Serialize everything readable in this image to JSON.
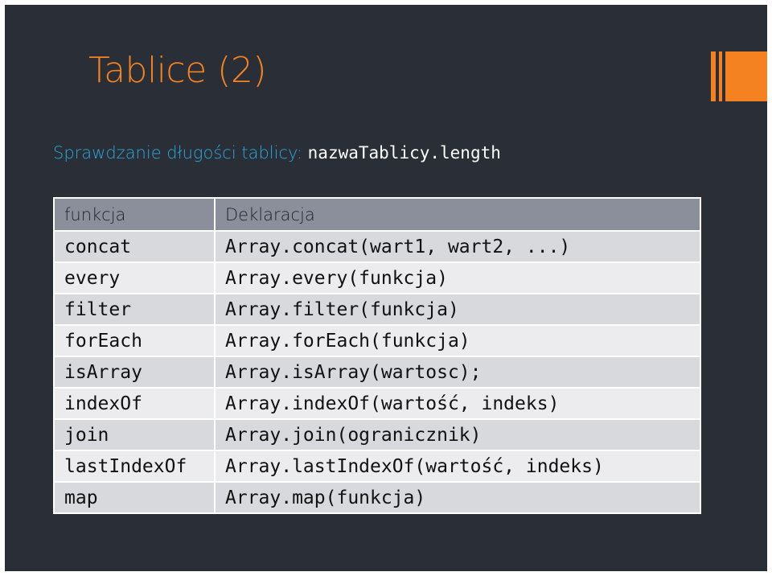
{
  "slide": {
    "title": "Tablice (2)",
    "subtitle_text": "Sprawdzanie długości tablicy: ",
    "subtitle_code": "nazwaTablicy.length"
  },
  "colors": {
    "background": "#2a2e37",
    "accent": "#f58220",
    "subtitle": "#2aa9d8",
    "header_row": "#8a8f9b"
  },
  "table": {
    "headers": [
      "funkcja",
      "Deklaracja"
    ],
    "rows": [
      {
        "name": "concat",
        "decl": "Array.concat(wart1, wart2, ...)"
      },
      {
        "name": "every",
        "decl": "Array.every(funkcja)"
      },
      {
        "name": "filter",
        "decl": "Array.filter(funkcja)"
      },
      {
        "name": "forEach",
        "decl": "Array.forEach(funkcja)"
      },
      {
        "name": "isArray",
        "decl": "Array.isArray(wartosc);"
      },
      {
        "name": "indexOf",
        "decl": "Array.indexOf(wartość, indeks)"
      },
      {
        "name": "join",
        "decl": "Array.join(ogranicznik)"
      },
      {
        "name": "lastIndexOf",
        "decl": "Array.lastIndexOf(wartość, indeks)"
      },
      {
        "name": "map",
        "decl": "Array.map(funkcja)"
      }
    ]
  }
}
